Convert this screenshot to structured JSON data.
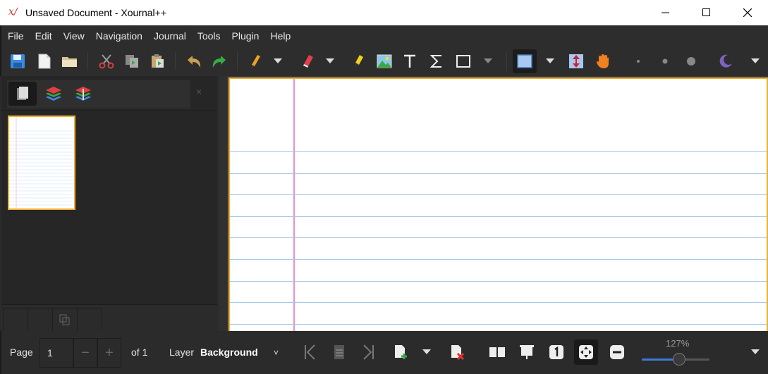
{
  "window": {
    "title": "Unsaved Document - Xournal++",
    "app_icon_glyph": "x∕",
    "icons": [
      "xournal-app-icon",
      "minimize-icon",
      "maximize-icon",
      "close-icon"
    ]
  },
  "menubar": {
    "items": [
      "File",
      "Edit",
      "View",
      "Navigation",
      "Journal",
      "Tools",
      "Plugin",
      "Help"
    ]
  },
  "toolbar": {
    "icons": [
      "save-icon",
      "new-document-icon",
      "open-folder-icon",
      "cut-icon",
      "copy-icon",
      "paste-icon",
      "undo-icon",
      "redo-icon",
      "pen-icon",
      "pen-dropdown-icon",
      "eraser-icon",
      "eraser-dropdown-icon",
      "highlighter-icon",
      "image-icon",
      "text-icon",
      "tex-sigma-icon",
      "shape-rectangle-icon",
      "shape-dropdown-icon",
      "select-rectangle-icon",
      "select-dropdown-icon",
      "vertical-space-icon",
      "hand-icon",
      "dot-small-icon",
      "dot-medium-icon",
      "dot-large-icon",
      "color-icon",
      "more-dropdown-icon"
    ],
    "colors": {
      "save": "#3d8ae0",
      "cut": "#d04040",
      "undo": "#c8a050",
      "redo": "#3aa844",
      "pen": "#f0a020",
      "eraser": "#e04050",
      "highlighter": "#f0d020",
      "select": "#a8c8f0",
      "hand": "#f08020",
      "color": "#8060c0"
    }
  },
  "sidebar": {
    "tabs": [
      "page-preview-tab",
      "layers-tab",
      "layer-preview-tab"
    ],
    "close_glyph": "×"
  },
  "document": {
    "paper_color": "#ffffff",
    "rule_color": "#a8c8ea",
    "margin_color": "#d020a0",
    "border_color": "#f0b030"
  },
  "statusbar": {
    "page_label": "Page",
    "page_value": "1",
    "minus_glyph": "−",
    "plus_glyph": "+",
    "of_label": "of 1",
    "layer_label": "Layer",
    "layer_value": "Background",
    "layer_dropdown_glyph": "˅",
    "zoom_label": "127%",
    "zoom_level": 0.55
  }
}
